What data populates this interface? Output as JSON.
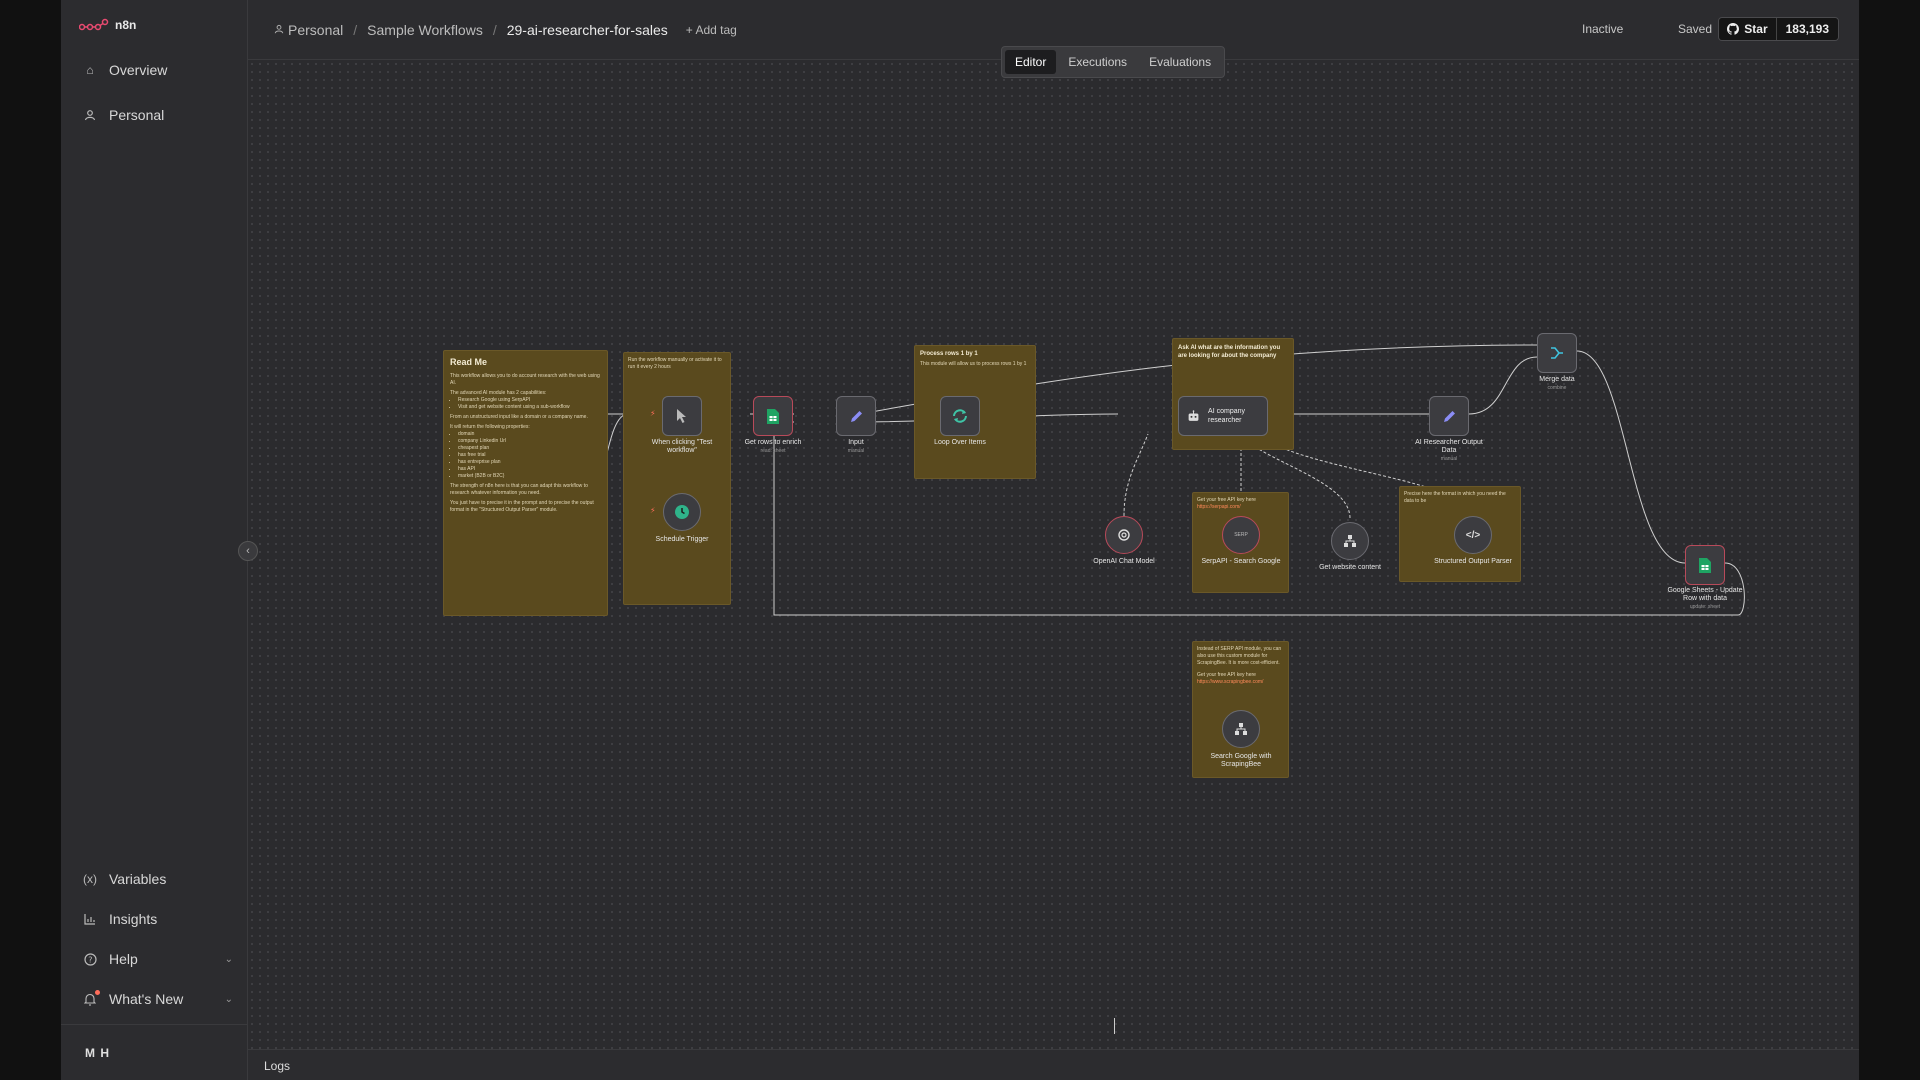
{
  "brand": {
    "name": "n8n"
  },
  "sidebar": {
    "items": [
      {
        "label": "Overview",
        "icon": "home-icon"
      },
      {
        "label": "Personal",
        "icon": "user-icon"
      }
    ],
    "bottom_items": [
      {
        "label": "Variables",
        "icon": "variables-icon"
      },
      {
        "label": "Insights",
        "icon": "chart-icon"
      },
      {
        "label": "Help",
        "icon": "help-icon"
      },
      {
        "label": "What's New",
        "icon": "bell-icon"
      }
    ],
    "user_initials": "M H"
  },
  "header": {
    "crumbs": [
      "Personal",
      "Sample Workflows",
      "29-ai-researcher-for-sales"
    ],
    "add_tag": "+ Add tag",
    "status": "Inactive",
    "saved": "Saved",
    "github_star": "Star",
    "github_count": "183,193"
  },
  "tabs": [
    "Editor",
    "Executions",
    "Evaluations"
  ],
  "logs_label": "Logs",
  "notes": {
    "readme": {
      "title": "Read Me",
      "p1": "This workflow allows you to do account research with the web using AI.",
      "p2": "The advanced AI module has 2 capabilities:",
      "caps": [
        "Research Google using SerpAPI",
        "Visit and get website content using a sub-workflow"
      ],
      "p3": "From an unstructured input like a domain or a company name.",
      "p4": "It will return the following properties:",
      "props": [
        "domain",
        "company Linkedin Url",
        "cheapest plan",
        "has free trial",
        "has entreprise plan",
        "has API",
        "market (B2B or B2C)"
      ],
      "p5": "The strength of n8n here is that you can adapt this workflow to research whatever information you need.",
      "p6": "You just have to precise it in the prompt and to precise the output format in the \"Structured Output Parser\" module."
    },
    "trigger": {
      "text": "Run the workflow manually or activate it to run it every 2 hours"
    },
    "loop": {
      "title": "Process rows 1 by 1",
      "text": "This module will allow us to process rows 1 by 1"
    },
    "ai": {
      "title": "Ask AI what are the information you are looking for about the company"
    },
    "serp": {
      "text": "Get your free API key here",
      "link": "https://serpapi.com/"
    },
    "parser": {
      "text": "Precise here the format in which you need the data to be"
    },
    "scraping": {
      "text": "Instead of SERP API module, you can also use this custom module for ScrapingBee. It is more cost-efficient.",
      "text2": "Get your free API key here",
      "link": "https://www.scrapingbee.com/"
    }
  },
  "nodes": {
    "manual": {
      "label": "When clicking \"Test workflow\""
    },
    "schedule": {
      "label": "Schedule Trigger"
    },
    "get_rows": {
      "label": "Get rows to enrich",
      "sub": "read: sheet"
    },
    "input": {
      "label": "Input",
      "sub": "manual"
    },
    "loop": {
      "label": "Loop Over Items"
    },
    "ai_agent": {
      "label": "AI company researcher"
    },
    "ai_output": {
      "label": "AI Researcher Output Data",
      "sub": "manual"
    },
    "merge": {
      "label": "Merge data",
      "sub": "combine"
    },
    "gsheets": {
      "label": "Google Sheets - Update Row with data",
      "sub": "update: sheet"
    },
    "openai": {
      "label": "OpenAI Chat Model"
    },
    "serpapi": {
      "label": "SerpAPI - Search Google"
    },
    "website": {
      "label": "Get website content"
    },
    "parser": {
      "label": "Structured Output Parser"
    },
    "scrapingbee": {
      "label": "Search Google with ScrapingBee"
    }
  },
  "colors": {
    "note_bg": "#5a4a1e",
    "canvas_bg": "#2b2b2e",
    "accent": "#ff6d5a",
    "sheets_green": "#1fa463"
  }
}
